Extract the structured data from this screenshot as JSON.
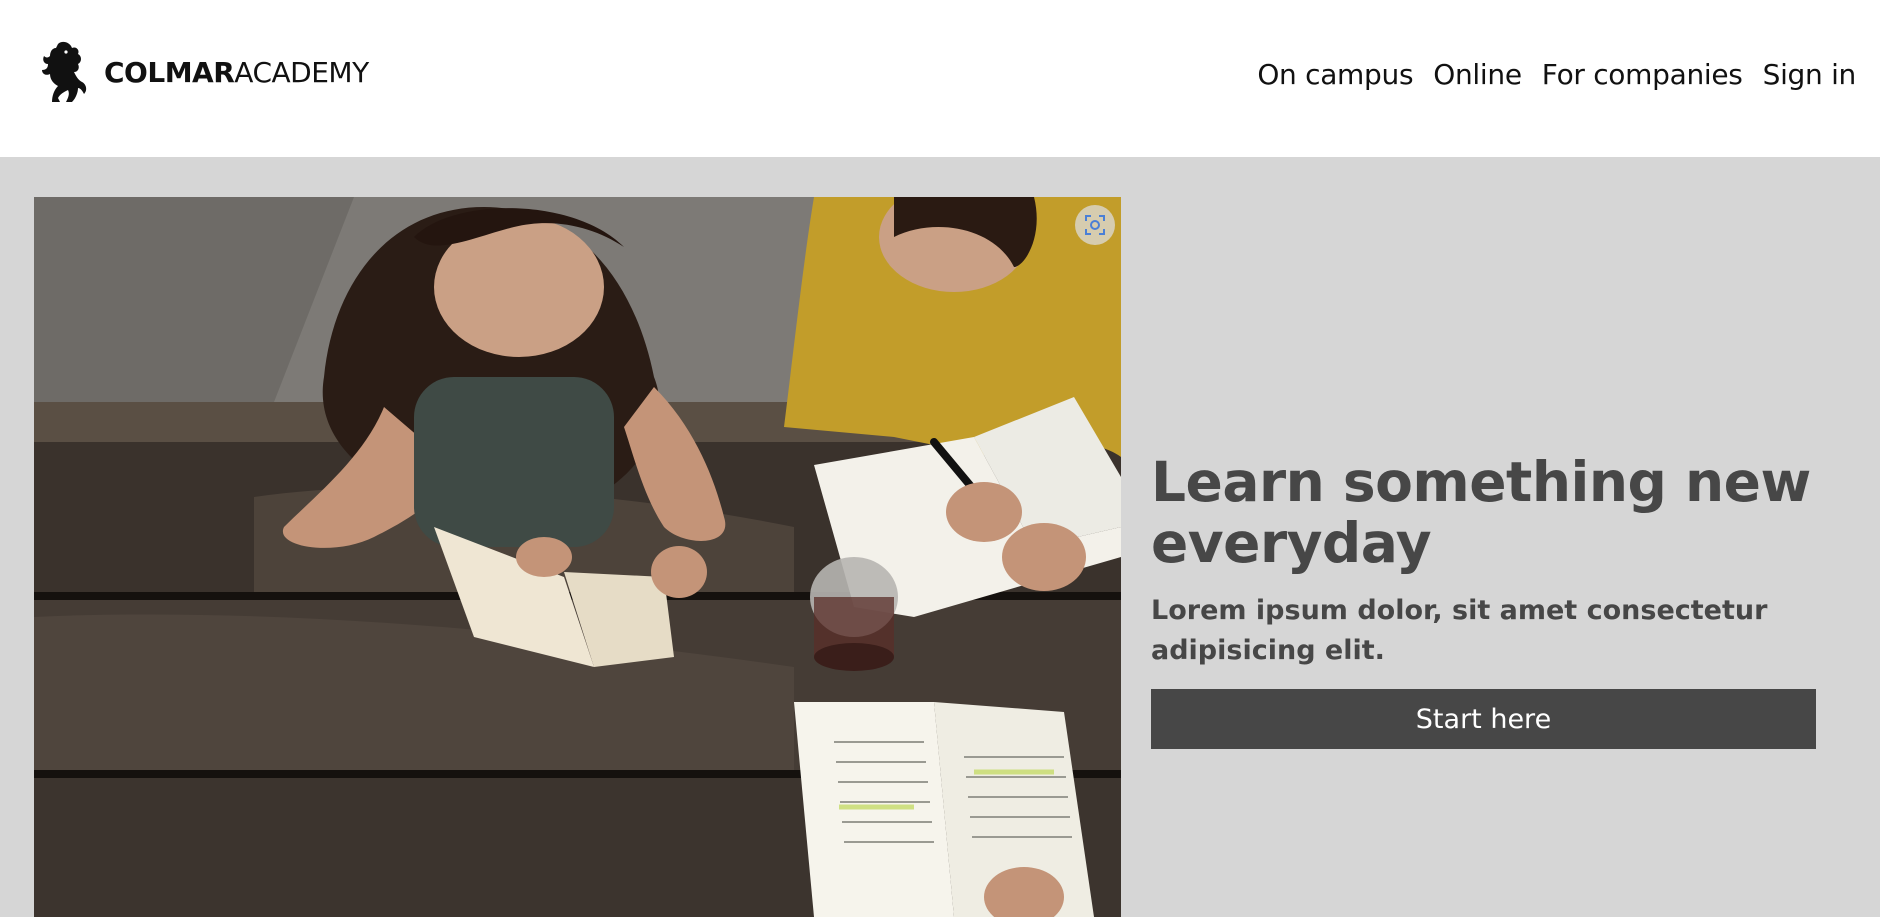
{
  "brand": {
    "name_bold": "COLMAR",
    "name_light": "ACADEMY",
    "icon": "lion-rampant-icon"
  },
  "nav": {
    "items": [
      {
        "label": "On campus"
      },
      {
        "label": "Online"
      },
      {
        "label": "For companies"
      },
      {
        "label": "Sign in"
      }
    ]
  },
  "hero": {
    "title": "Learn something new everyday",
    "subtitle": "Lorem ipsum dolor, sit amet consectetur adipisicing elit.",
    "cta_label": "Start here",
    "image_icon": "visual-search-icon"
  },
  "colors": {
    "background": "#d6d6d6",
    "header": "#ffffff",
    "text": "#474747",
    "button": "#474747",
    "button_text": "#ffffff"
  }
}
